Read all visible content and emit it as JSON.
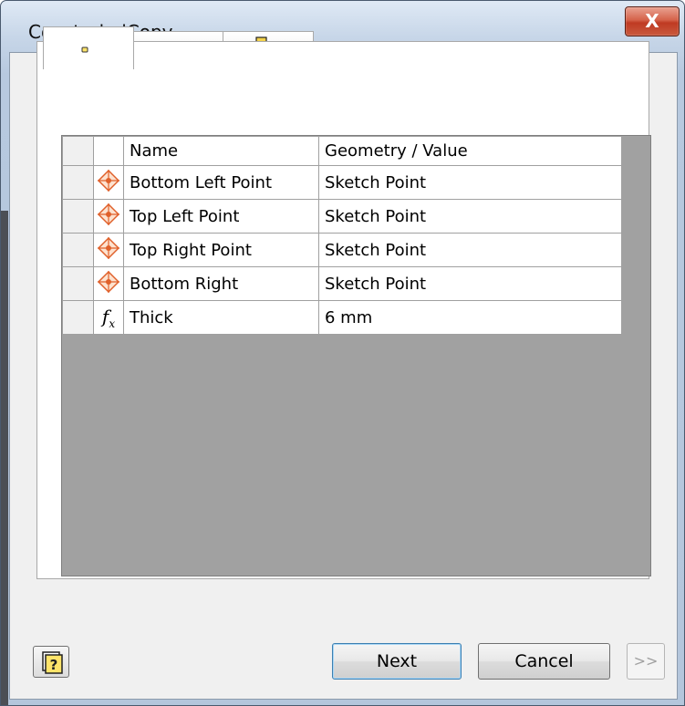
{
  "window": {
    "title": "Constrain iCopy",
    "close_label": "X"
  },
  "tabs": [
    {
      "name": "points-tab",
      "icon": "single-point-icon"
    },
    {
      "name": "pattern-tab",
      "icon": "point-chain-icon"
    },
    {
      "name": "assembly-tab",
      "icon": "assembly-constraint-icon"
    }
  ],
  "grid": {
    "columns": [
      "Name",
      "Geometry / Value"
    ],
    "rows": [
      {
        "icon": "sketch-point-icon",
        "name": "Bottom Left Point",
        "value": "Sketch Point"
      },
      {
        "icon": "sketch-point-icon",
        "name": "Top Left Point",
        "value": "Sketch Point"
      },
      {
        "icon": "sketch-point-icon",
        "name": "Top Right Point",
        "value": "Sketch Point"
      },
      {
        "icon": "sketch-point-icon",
        "name": "Bottom Right",
        "value": "Sketch Point"
      },
      {
        "icon": "fx-parameter-icon",
        "name": "Thick",
        "value": "6 mm"
      }
    ]
  },
  "footer": {
    "next_label": "Next",
    "cancel_label": "Cancel",
    "more_label": ">>"
  },
  "colors": {
    "point_icon": "#e0602a",
    "grid_empty": "#a1a1a1",
    "title_bar": "#c7d6e8"
  }
}
